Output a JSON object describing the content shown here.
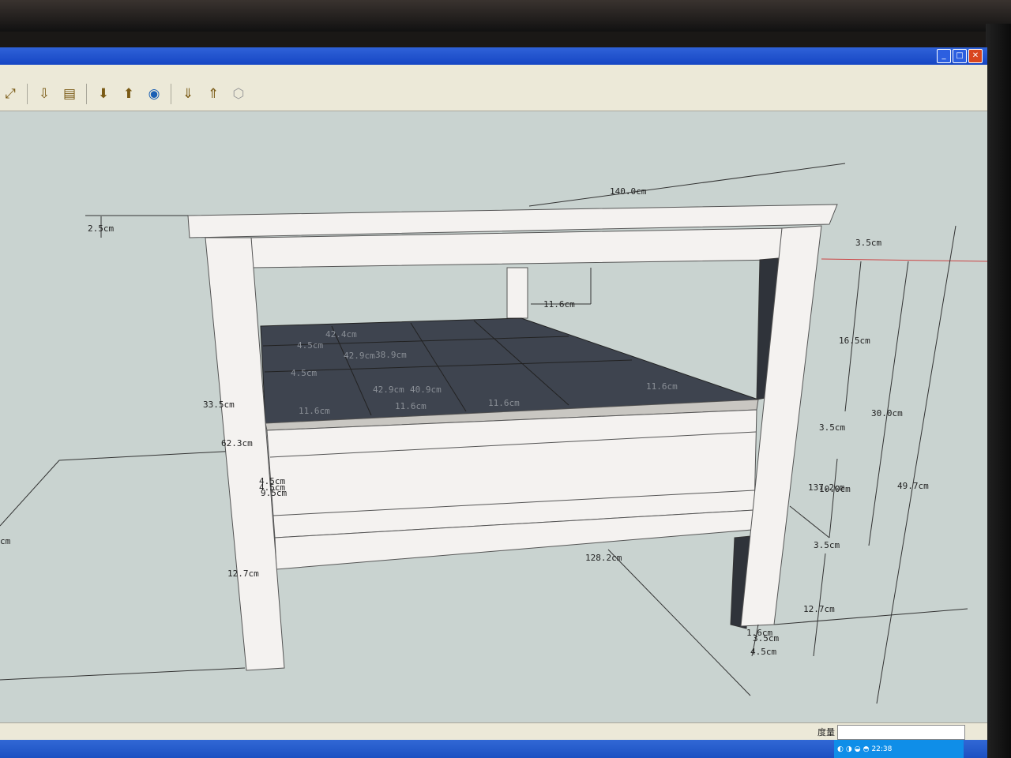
{
  "window": {
    "minimize": "_",
    "maximize": "□",
    "close": "✕"
  },
  "toolbar": {
    "icons": [
      "zoom-extents-icon",
      "previous-view-icon",
      "next-view-icon",
      "place-model-icon",
      "get-current-view-icon",
      "google-earth-icon",
      "get-models-icon",
      "share-model-icon",
      "components-icon"
    ]
  },
  "dimensions": {
    "d_140": "140.0cm",
    "d_2_5": "2.5cm",
    "d_3_5_top": "3.5cm",
    "d_11_6_top": "11.6cm",
    "d_16_5": "16.5cm",
    "d_30_0": "30.0cm",
    "d_49_7": "49.7cm",
    "d_3_5_mid": "3.5cm",
    "d_137_2": "137.2cm",
    "d_10_0": "10.0cm",
    "d_3_5_low": "3.5cm",
    "d_12_7_right": "12.7cm",
    "d_128_2": "128.2cm",
    "d_33_5": "33.5cm",
    "d_62_3": "62.3cm",
    "d_9_5": "9.5cm",
    "d_12_7_left": "12.7cm",
    "d_4_5a": "4.5cm",
    "d_4_5b": "4.5cm",
    "d_1_6": "1.6cm",
    "d_3_5_foot": "3.5cm",
    "d_4_5_foot": "4.5cm",
    "d_cm_left": "cm",
    "grid_42_4": "42.4cm",
    "grid_42_9a": "42.9cm",
    "grid_38_9": "38.9cm",
    "grid_42_9b": "42.9cm",
    "grid_40_9": "40.9cm",
    "grid_11_6a": "11.6cm",
    "grid_11_6b": "11.6cm",
    "grid_11_6c": "11.6cm",
    "grid_11_6d": "11.6cm",
    "grid_4_5a": "4.5cm",
    "grid_4_5b": "4.5cm"
  },
  "status": {
    "measure_label": "度量",
    "measure_value": ""
  },
  "taskbar": {
    "clock": "22:38"
  },
  "colors": {
    "background": "#c9d3d0",
    "panel": "#f4f2f0",
    "shelf": "#3e444f",
    "titlebar": "#1646c4"
  }
}
